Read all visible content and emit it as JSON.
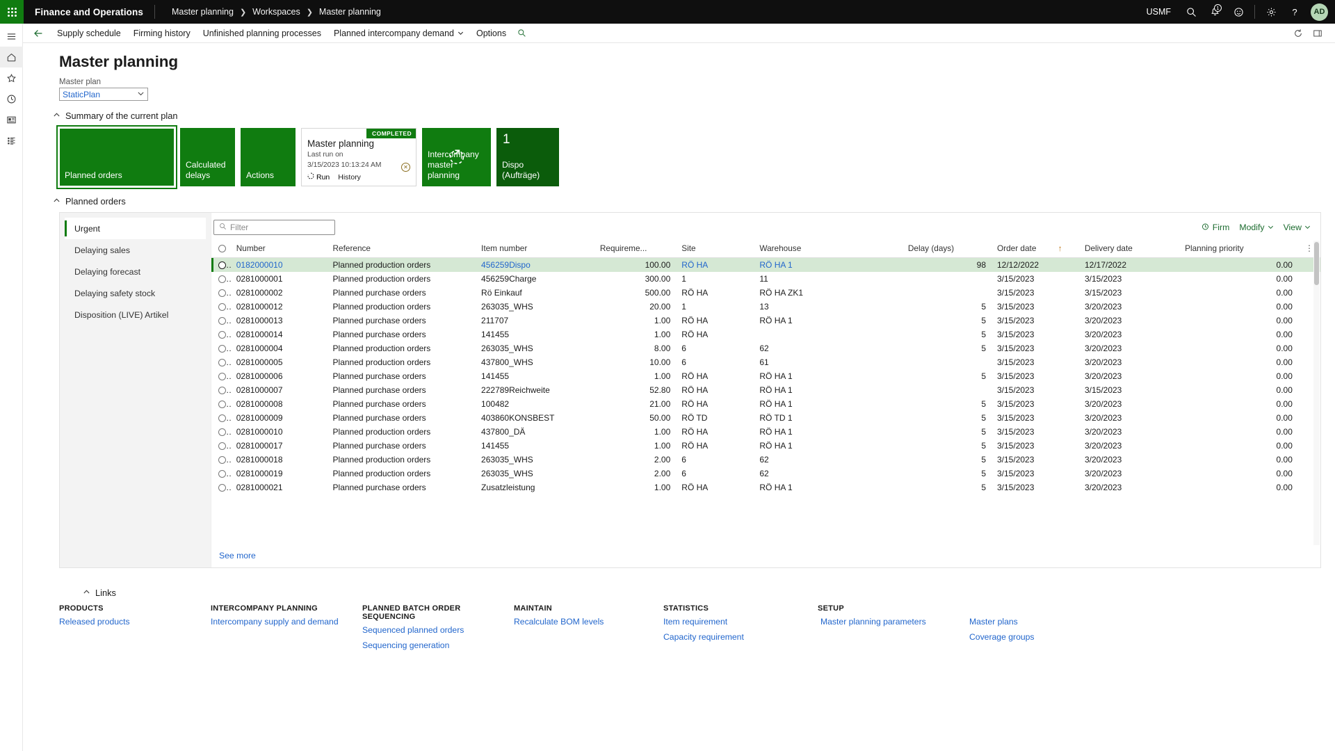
{
  "topbar": {
    "app_title": "Finance and Operations",
    "breadcrumb": [
      "Master planning",
      "Workspaces",
      "Master planning"
    ],
    "company": "USMF",
    "notification_count": "1",
    "avatar_initials": "AD",
    "icons": {
      "search": "search-icon",
      "notifications": "notification-bell-icon",
      "feedback": "smiley-feedback-icon",
      "settings": "gear-icon",
      "help": "question-help-icon"
    }
  },
  "rail": {
    "items": [
      {
        "name": "hamburger-menu",
        "label": "Expand navigation"
      },
      {
        "name": "home",
        "label": "Home"
      },
      {
        "name": "favorites-star",
        "label": "Favorites"
      },
      {
        "name": "recent-clock",
        "label": "Recent"
      },
      {
        "name": "workspaces",
        "label": "Workspaces"
      },
      {
        "name": "modules-list",
        "label": "Modules"
      }
    ]
  },
  "actionbar": {
    "items": [
      {
        "label": "Supply schedule",
        "caret": false
      },
      {
        "label": "Firming history",
        "caret": false
      },
      {
        "label": "Unfinished planning processes",
        "caret": false
      },
      {
        "label": "Planned intercompany demand",
        "caret": true
      },
      {
        "label": "Options",
        "caret": false
      }
    ],
    "search_icon": "search-icon",
    "refresh_icon": "refresh-icon",
    "attachments_icon": "attachment-panel-icon"
  },
  "page": {
    "title": "Master planning",
    "master_plan_label": "Master plan",
    "master_plan_value": "StaticPlan"
  },
  "summary": {
    "section_label": "Summary of the current plan",
    "tiles": [
      {
        "label": "Planned orders",
        "count": "",
        "selected": true,
        "kind": "wide"
      },
      {
        "label": "Calculated delays",
        "count": "",
        "selected": false,
        "kind": "med"
      },
      {
        "label": "Actions",
        "count": "",
        "selected": false,
        "kind": "med"
      },
      {
        "label": "Intercompany master planning",
        "count": "",
        "selected": false,
        "kind": "icon"
      },
      {
        "label": "Dispo (Aufträge)",
        "count": "1",
        "selected": false,
        "kind": "dispo"
      }
    ],
    "card": {
      "status": "COMPLETED",
      "title": "Master planning",
      "subtitle": "Last run on",
      "timestamp": "3/15/2023 10:13:24 AM",
      "run_label": "Run",
      "history_label": "History",
      "cancel_icon": "cancel-circle-icon"
    }
  },
  "planned_orders": {
    "section_label": "Planned orders",
    "tabs": [
      "Urgent",
      "Delaying sales",
      "Delaying forecast",
      "Delaying safety stock",
      "Disposition (LIVE) Artikel"
    ],
    "active_tab": "Urgent",
    "filter_placeholder": "Filter",
    "toolbar": [
      {
        "label": "Firm",
        "caret": false,
        "icon": "firm-clock-icon"
      },
      {
        "label": "Modify",
        "caret": true,
        "icon": ""
      },
      {
        "label": "View",
        "caret": true,
        "icon": ""
      }
    ],
    "columns": [
      "Number",
      "Reference",
      "Item number",
      "Requireme...",
      "Site",
      "Warehouse",
      "Delay (days)",
      "Order date",
      "Delivery date",
      "Planning priority"
    ],
    "sorted_column": "Order date",
    "sort_direction": "asc",
    "see_more": "See more",
    "rows": [
      {
        "number": "0182000010",
        "reference": "Planned production orders",
        "item": "456259Dispo",
        "requirement": "100.00",
        "site": "RÖ HA",
        "warehouse": "RÖ HA 1",
        "delay": "98",
        "order_date": "12/12/2022",
        "delivery_date": "12/17/2022",
        "priority": "0.00",
        "selected": true
      },
      {
        "number": "0281000001",
        "reference": "Planned production orders",
        "item": "456259Charge",
        "requirement": "300.00",
        "site": "1",
        "warehouse": "11",
        "delay": "",
        "order_date": "3/15/2023",
        "delivery_date": "3/15/2023",
        "priority": "0.00",
        "selected": false
      },
      {
        "number": "0281000002",
        "reference": "Planned purchase orders",
        "item": "Rö Einkauf",
        "requirement": "500.00",
        "site": "RÖ HA",
        "warehouse": "RÖ HA ZK1",
        "delay": "",
        "order_date": "3/15/2023",
        "delivery_date": "3/15/2023",
        "priority": "0.00",
        "selected": false
      },
      {
        "number": "0281000012",
        "reference": "Planned production orders",
        "item": "263035_WHS",
        "requirement": "20.00",
        "site": "1",
        "warehouse": "13",
        "delay": "5",
        "order_date": "3/15/2023",
        "delivery_date": "3/20/2023",
        "priority": "0.00",
        "selected": false
      },
      {
        "number": "0281000013",
        "reference": "Planned purchase orders",
        "item": "211707",
        "requirement": "1.00",
        "site": "RÖ HA",
        "warehouse": "RÖ HA 1",
        "delay": "5",
        "order_date": "3/15/2023",
        "delivery_date": "3/20/2023",
        "priority": "0.00",
        "selected": false
      },
      {
        "number": "0281000014",
        "reference": "Planned purchase orders",
        "item": "141455",
        "requirement": "1.00",
        "site": "RÖ HA",
        "warehouse": "",
        "delay": "5",
        "order_date": "3/15/2023",
        "delivery_date": "3/20/2023",
        "priority": "0.00",
        "selected": false
      },
      {
        "number": "0281000004",
        "reference": "Planned production orders",
        "item": "263035_WHS",
        "requirement": "8.00",
        "site": "6",
        "warehouse": "62",
        "delay": "5",
        "order_date": "3/15/2023",
        "delivery_date": "3/20/2023",
        "priority": "0.00",
        "selected": false
      },
      {
        "number": "0281000005",
        "reference": "Planned production orders",
        "item": "437800_WHS",
        "requirement": "10.00",
        "site": "6",
        "warehouse": "61",
        "delay": "",
        "order_date": "3/15/2023",
        "delivery_date": "3/20/2023",
        "priority": "0.00",
        "selected": false
      },
      {
        "number": "0281000006",
        "reference": "Planned purchase orders",
        "item": "141455",
        "requirement": "1.00",
        "site": "RÖ HA",
        "warehouse": "RÖ HA 1",
        "delay": "5",
        "order_date": "3/15/2023",
        "delivery_date": "3/20/2023",
        "priority": "0.00",
        "selected": false
      },
      {
        "number": "0281000007",
        "reference": "Planned purchase orders",
        "item": "222789Reichweite",
        "requirement": "52.80",
        "site": "RÖ HA",
        "warehouse": "RÖ HA 1",
        "delay": "",
        "order_date": "3/15/2023",
        "delivery_date": "3/15/2023",
        "priority": "0.00",
        "selected": false
      },
      {
        "number": "0281000008",
        "reference": "Planned purchase orders",
        "item": "100482",
        "requirement": "21.00",
        "site": "RÖ HA",
        "warehouse": "RÖ HA 1",
        "delay": "5",
        "order_date": "3/15/2023",
        "delivery_date": "3/20/2023",
        "priority": "0.00",
        "selected": false
      },
      {
        "number": "0281000009",
        "reference": "Planned purchase orders",
        "item": "403860KONSBEST",
        "requirement": "50.00",
        "site": "RÖ TD",
        "warehouse": "RÖ TD 1",
        "delay": "5",
        "order_date": "3/15/2023",
        "delivery_date": "3/20/2023",
        "priority": "0.00",
        "selected": false
      },
      {
        "number": "0281000010",
        "reference": "Planned production orders",
        "item": "437800_DÄ",
        "requirement": "1.00",
        "site": "RÖ HA",
        "warehouse": "RÖ HA 1",
        "delay": "5",
        "order_date": "3/15/2023",
        "delivery_date": "3/20/2023",
        "priority": "0.00",
        "selected": false
      },
      {
        "number": "0281000017",
        "reference": "Planned purchase orders",
        "item": "141455",
        "requirement": "1.00",
        "site": "RÖ HA",
        "warehouse": "RÖ HA 1",
        "delay": "5",
        "order_date": "3/15/2023",
        "delivery_date": "3/20/2023",
        "priority": "0.00",
        "selected": false
      },
      {
        "number": "0281000018",
        "reference": "Planned production orders",
        "item": "263035_WHS",
        "requirement": "2.00",
        "site": "6",
        "warehouse": "62",
        "delay": "5",
        "order_date": "3/15/2023",
        "delivery_date": "3/20/2023",
        "priority": "0.00",
        "selected": false
      },
      {
        "number": "0281000019",
        "reference": "Planned production orders",
        "item": "263035_WHS",
        "requirement": "2.00",
        "site": "6",
        "warehouse": "62",
        "delay": "5",
        "order_date": "3/15/2023",
        "delivery_date": "3/20/2023",
        "priority": "0.00",
        "selected": false
      },
      {
        "number": "0281000021",
        "reference": "Planned purchase orders",
        "item": "Zusatzleistung",
        "requirement": "1.00",
        "site": "RÖ HA",
        "warehouse": "RÖ HA 1",
        "delay": "5",
        "order_date": "3/15/2023",
        "delivery_date": "3/20/2023",
        "priority": "0.00",
        "selected": false
      }
    ]
  },
  "links": {
    "section_label": "Links",
    "columns": [
      {
        "heading": "PRODUCTS",
        "items": [
          "Released products"
        ]
      },
      {
        "heading": "INTERCOMPANY PLANNING",
        "items": [
          "Intercompany supply and demand"
        ]
      },
      {
        "heading": "PLANNED BATCH ORDER SEQUENCING",
        "items": [
          "Sequenced planned orders",
          "Sequencing generation"
        ]
      },
      {
        "heading": "MAINTAIN",
        "items": [
          "Recalculate BOM levels"
        ]
      },
      {
        "heading": "STATISTICS",
        "items": [
          "Item requirement",
          "Capacity requirement"
        ]
      },
      {
        "heading": "SETUP",
        "items": [
          "Master planning parameters"
        ]
      },
      {
        "heading": "",
        "items": [
          "Master plans",
          "Coverage groups"
        ]
      }
    ]
  },
  "colors": {
    "brand_green": "#107c10",
    "dark_green": "#0b5c0b",
    "link_blue": "#2266cc",
    "selected_row": "#d5e8d4",
    "nav_black": "#0f0f0f"
  }
}
